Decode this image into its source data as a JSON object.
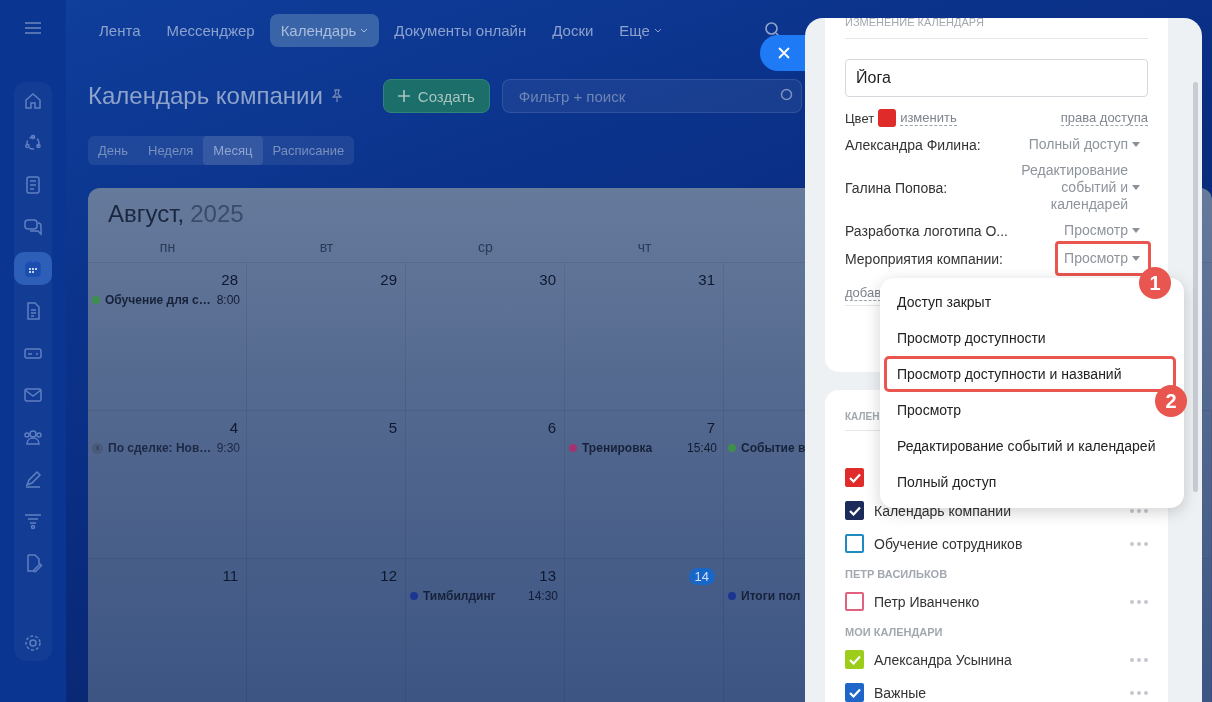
{
  "sidebar": [
    {
      "selected": false
    },
    {
      "selected": false
    },
    {
      "selected": false
    },
    {
      "selected": false
    },
    {
      "selected": true
    },
    {
      "selected": false
    },
    {
      "selected": false
    },
    {
      "selected": false
    },
    {
      "selected": false
    },
    {
      "selected": false
    },
    {
      "selected": false
    },
    {
      "selected": false
    },
    {
      "selected": false
    }
  ],
  "nav": [
    {
      "label": "Лента",
      "selected": false,
      "caret": false
    },
    {
      "label": "Мессенджер",
      "selected": false,
      "caret": false
    },
    {
      "label": "Календарь",
      "selected": true,
      "caret": true
    },
    {
      "label": "Документы онлайн",
      "selected": false,
      "caret": false
    },
    {
      "label": "Доски",
      "selected": false,
      "caret": false
    },
    {
      "label": "Еще",
      "selected": false,
      "caret": true
    }
  ],
  "page_title": "Календарь компании",
  "create_button": "Создать",
  "search": {
    "placeholder": "Фильтр + поиск"
  },
  "view_tabs": [
    {
      "label": "День",
      "selected": false
    },
    {
      "label": "Неделя",
      "selected": false
    },
    {
      "label": "Месяц",
      "selected": true
    },
    {
      "label": "Расписание",
      "selected": false
    }
  ],
  "calendar": {
    "month": "Август,",
    "year": "2025",
    "weekdays": [
      "пн",
      "вт",
      "ср",
      "чт"
    ],
    "weeks": [
      [
        {
          "date": "28",
          "today": false,
          "events": [
            {
              "kind": "event",
              "title": "Обучение для с…",
              "time": "8:00",
              "color": "#3f8f4c"
            }
          ]
        },
        {
          "date": "29",
          "today": false
        },
        {
          "date": "30",
          "today": false
        },
        {
          "date": "31",
          "today": false
        }
      ],
      [
        {
          "date": "4",
          "today": false,
          "events": [
            {
              "kind": "deal",
              "title": "По сделке: Нов…",
              "time": "9:30"
            }
          ]
        },
        {
          "date": "5",
          "today": false
        },
        {
          "date": "6",
          "today": false
        },
        {
          "date": "7",
          "today": false,
          "events": [
            {
              "kind": "event",
              "title": "Тренировка",
              "time": "15:40",
              "color": "#a3326e"
            }
          ]
        },
        {
          "events": [
            {
              "kind": "event",
              "title": "Событие в",
              "color": "#3f8f4c"
            }
          ]
        }
      ],
      [
        {
          "date": "11",
          "today": false
        },
        {
          "date": "12",
          "today": false
        },
        {
          "date": "13",
          "today": false,
          "events": [
            {
              "kind": "event",
              "title": "Тимбилдинг",
              "time": "14:30",
              "color": "#1b3590"
            }
          ]
        },
        {
          "date": "14",
          "today": true
        },
        {
          "events": [
            {
              "kind": "event",
              "title": "Итоги пол",
              "color": "#1b3590"
            }
          ]
        }
      ]
    ]
  },
  "panel": {
    "header": "ИЗМЕНЕНИЕ КАЛЕНДАРЯ",
    "name_value": "Йога",
    "color_label": "Цвет",
    "color": "#e02b2b",
    "change_link": "изменить",
    "access_link": "права доступа",
    "access": [
      {
        "name": "Александра Филина:",
        "level": "Полный доступ",
        "callout": false
      },
      {
        "name": "Галина Попова:",
        "level": "Редактирование событий и календарей",
        "callout": false
      },
      {
        "name": "Разработка логотипа О...",
        "level": "Просмотр",
        "callout": false
      },
      {
        "name": "Мероприятия компании:",
        "level": "Просмотр",
        "callout": true
      }
    ],
    "add_link": "добав",
    "callout_1": "1",
    "dropdown": [
      {
        "label": "Доступ закрыт",
        "callout": false
      },
      {
        "label": "Просмотр доступности",
        "callout": false
      },
      {
        "label": "Просмотр доступности и названий",
        "callout": true
      },
      {
        "label": "Просмотр",
        "callout": false
      },
      {
        "label": "Редактирование событий и календарей",
        "callout": false
      },
      {
        "label": "Полный доступ",
        "callout": false
      }
    ],
    "callout_2": "2",
    "groups": [
      {
        "heading": "КАЛЕН",
        "items": [
          {
            "checked": true,
            "color": "#e02b2b"
          },
          {
            "label": "Календарь компании",
            "checked": true,
            "color": "#1d2b5a"
          },
          {
            "label": "Обучение сотрудников",
            "checked": false,
            "color": "#1f8ac0"
          }
        ]
      },
      {
        "heading": "ПЕТР ВАСИЛЬКОВ",
        "items": [
          {
            "label": "Петр Иванченко",
            "checked": false,
            "color": "#e0607e"
          }
        ]
      },
      {
        "heading": "МОИ КАЛЕНДАРИ",
        "items": [
          {
            "label": "Александра Усынина",
            "checked": true,
            "color": "#9ccd1a"
          },
          {
            "label": "Важные",
            "checked": true,
            "color": "#1f66c8"
          }
        ]
      }
    ]
  }
}
